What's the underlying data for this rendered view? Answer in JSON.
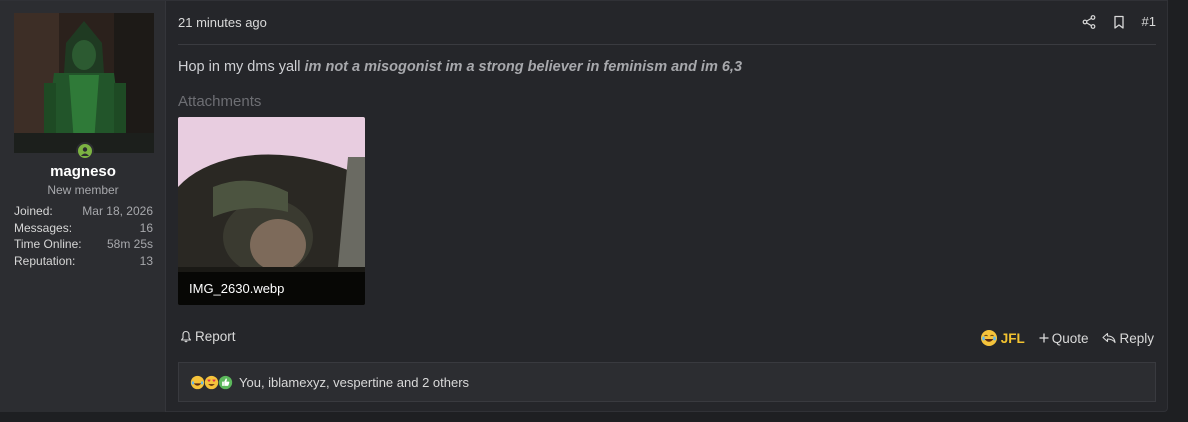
{
  "user": {
    "username": "magneso",
    "title": "New member",
    "stats": [
      {
        "label": "Joined:",
        "value": "Mar 18, 2026"
      },
      {
        "label": "Messages:",
        "value": "16"
      },
      {
        "label": "Time Online:",
        "value": "58m 25s"
      },
      {
        "label": "Reputation:",
        "value": "13"
      }
    ],
    "online": true
  },
  "post": {
    "timestamp": "21 minutes ago",
    "number": "#1",
    "message_plain": "Hop in my dms yall",
    "message_emph": "im not a misogonist im a strong believer in feminism and im 6,3",
    "attachments_title": "Attachments",
    "attachment": {
      "filename": "IMG_2630.webp"
    }
  },
  "actions": {
    "report": "Report",
    "reaction": "JFL",
    "quote": "Quote",
    "reply": "Reply"
  },
  "reactions": {
    "text": "You, iblamexyz, vespertine and 2 others",
    "icons": [
      "laughing-face-icon",
      "heart-eyes-icon",
      "thumbs-up-icon"
    ]
  },
  "colors": {
    "accent_yellow": "#f2c230",
    "online_green": "#7cb342",
    "background": "#25262a",
    "sidebar": "#2c2d31"
  }
}
